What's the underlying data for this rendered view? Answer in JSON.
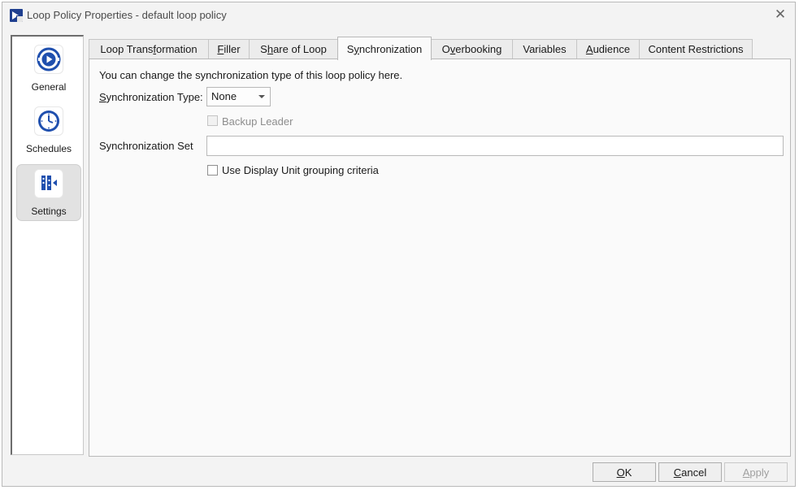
{
  "window": {
    "title": "Loop Policy Properties - default loop policy",
    "close_label": "✕"
  },
  "nav": {
    "items": [
      {
        "label": "General",
        "icon": "play-circle-icon"
      },
      {
        "label": "Schedules",
        "icon": "clock-icon"
      },
      {
        "label": "Settings",
        "icon": "settings-panel-icon"
      }
    ],
    "active": "Settings"
  },
  "tabs": [
    {
      "label": "Loop Transformation",
      "mnemonic": "f"
    },
    {
      "label": "Filler",
      "mnemonic": "F"
    },
    {
      "label": "Share of Loop",
      "mnemonic": "h"
    },
    {
      "label": "Synchronization",
      "mnemonic": "y"
    },
    {
      "label": "Overbooking",
      "mnemonic": "v"
    },
    {
      "label": "Variables",
      "mnemonic": ""
    },
    {
      "label": "Audience",
      "mnemonic": "A"
    },
    {
      "label": "Content Restrictions",
      "mnemonic": ""
    }
  ],
  "active_tab": "Synchronization",
  "sync": {
    "description": "You can change the synchronization type of this loop policy here.",
    "type_label": "Synchronization Type:",
    "type_value": "None",
    "backup_leader_label": "Backup Leader",
    "backup_leader_checked": false,
    "set_label": "Synchronization Set",
    "set_value": "",
    "use_display_unit_label": "Use Display Unit grouping criteria",
    "use_display_unit_checked": false
  },
  "buttons": {
    "ok": "OK",
    "cancel": "Cancel",
    "apply": "Apply"
  },
  "colors": {
    "accent": "#1f4fae",
    "window_bg": "#f3f3f3",
    "panel_bg": "#fafafa"
  }
}
